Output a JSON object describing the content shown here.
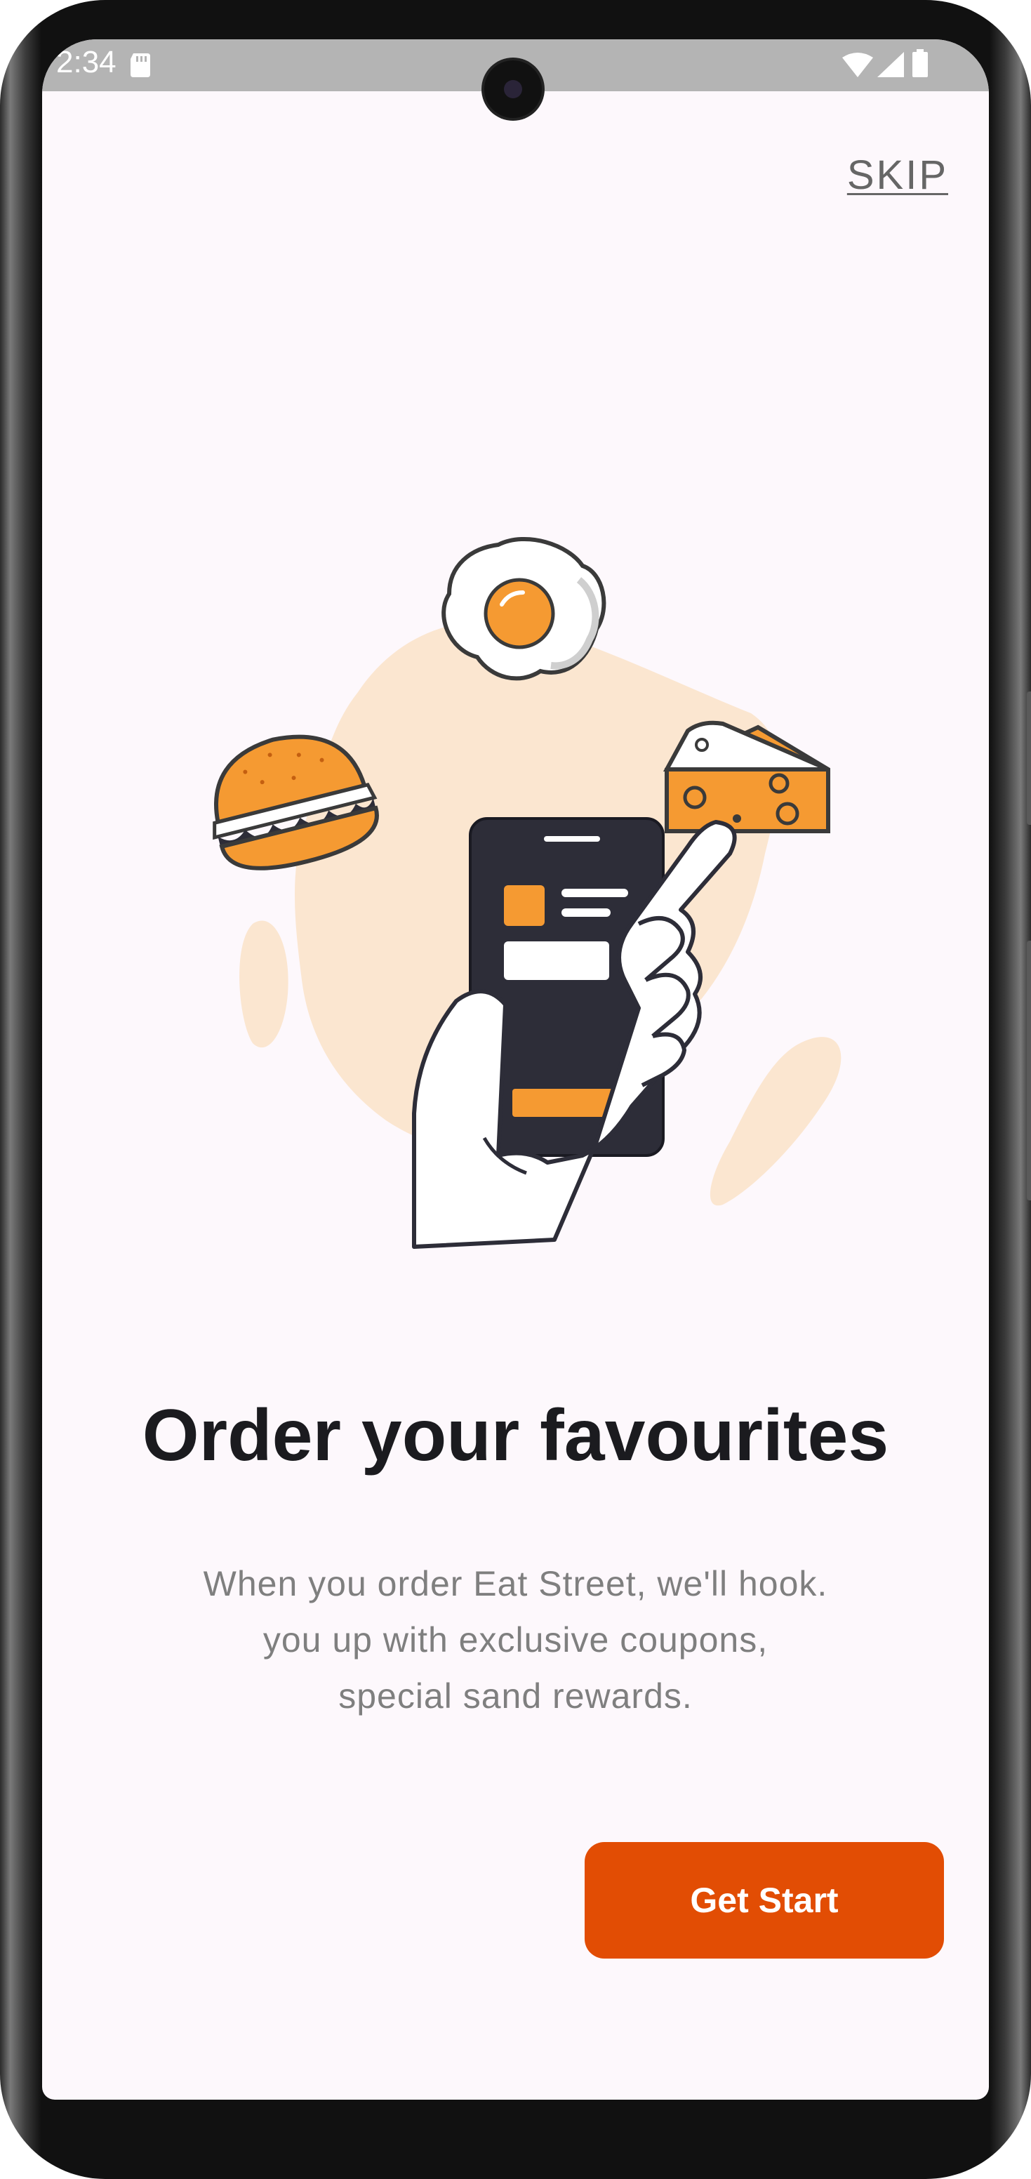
{
  "status_bar": {
    "time": "2:34",
    "icons": [
      "sd-card-icon",
      "wifi-icon",
      "cell-signal-icon",
      "battery-icon"
    ]
  },
  "onboarding": {
    "skip_label": "SKIP",
    "illustration": "hand-holding-phone-with-food-illustration",
    "title": "Order your favourites",
    "description_lines": [
      "When you order Eat Street, we'll hook.",
      "you up with exclusive coupons,",
      "special sand rewards."
    ],
    "cta_label": "Get Start"
  },
  "colors": {
    "accent": "#e24d04",
    "illustration_orange": "#f59a32",
    "blob": "#fbe6d0",
    "dark": "#2d2d38",
    "background": "#fdf8fc"
  }
}
